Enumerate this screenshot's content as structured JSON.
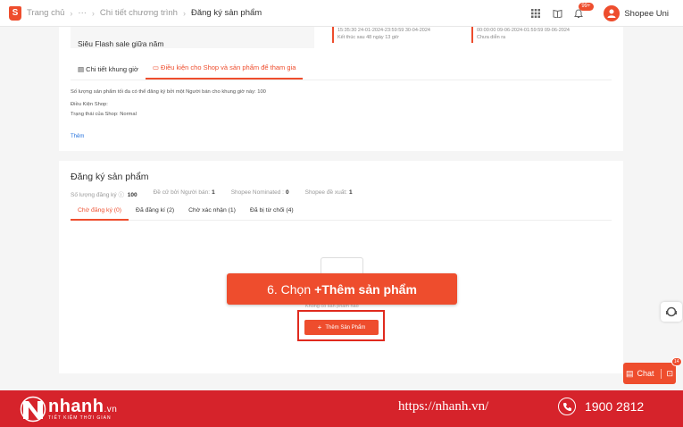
{
  "topbar": {
    "logo_glyph": "S",
    "breadcrumbs": [
      "Trang chủ",
      "···",
      "Chi tiết chương trình",
      "Đăng ký sản phẩm"
    ],
    "notification_count": "99+",
    "shop_name": "Shopee Uni"
  },
  "program": {
    "name": "Siêu Flash sale giữa năm",
    "time_a": {
      "line1": "15:35:30 24-01-2024-23:59:59 30-04-2024",
      "line2": "Kết thúc sau 48 ngày 13 giờ"
    },
    "time_b": {
      "line1": "00:00:00 09-06-2024-01:59:59 09-06-2024",
      "line2": "Chưa diễn ra"
    },
    "tabs": [
      "Chi tiết khung giờ",
      "Điều kiện cho Shop và sản phẩm để tham gia"
    ],
    "max_products": "Số lượng sản phẩm tối đa có thể đăng ký bởi một Người bán cho khung giờ này: 100",
    "shop_conditions_title": "Điều Kiện Shop:",
    "shop_status": "Trạng thái của Shop: Normal",
    "more_link": "Thêm"
  },
  "registration": {
    "title": "Đăng ký sản phẩm",
    "stats": [
      {
        "label": "Số lượng đăng ký",
        "value": "100"
      },
      {
        "label": "Đề cử bởi Người bán:",
        "value": "1"
      },
      {
        "label": "Shopee Nominated :",
        "value": "0"
      },
      {
        "label": "Shopee đề xuất:",
        "value": "1"
      }
    ],
    "tabs": [
      "Chờ đăng ký (0)",
      "Đã đăng kí (2)",
      "Chờ xác nhận (1)",
      "Đã bị từ chối (4)"
    ],
    "empty_text": "Không có sản phẩm nào",
    "add_button": "Thêm Sản Phẩm"
  },
  "callout": {
    "text": "6. Chọn",
    "bold": "+Thêm sản phẩm"
  },
  "chat": {
    "label": "Chat",
    "badge": "14"
  },
  "footer": {
    "brand_main": "nhanh",
    "brand_suffix": ".vn",
    "tagline": "TIẾT KIỆM THỜI GIAN",
    "url": "https://nhanh.vn/",
    "phone": "1900 2812"
  },
  "colors": {
    "accent": "#ee4d2d",
    "footer_bg": "#d6232b",
    "link": "#2673dd"
  }
}
